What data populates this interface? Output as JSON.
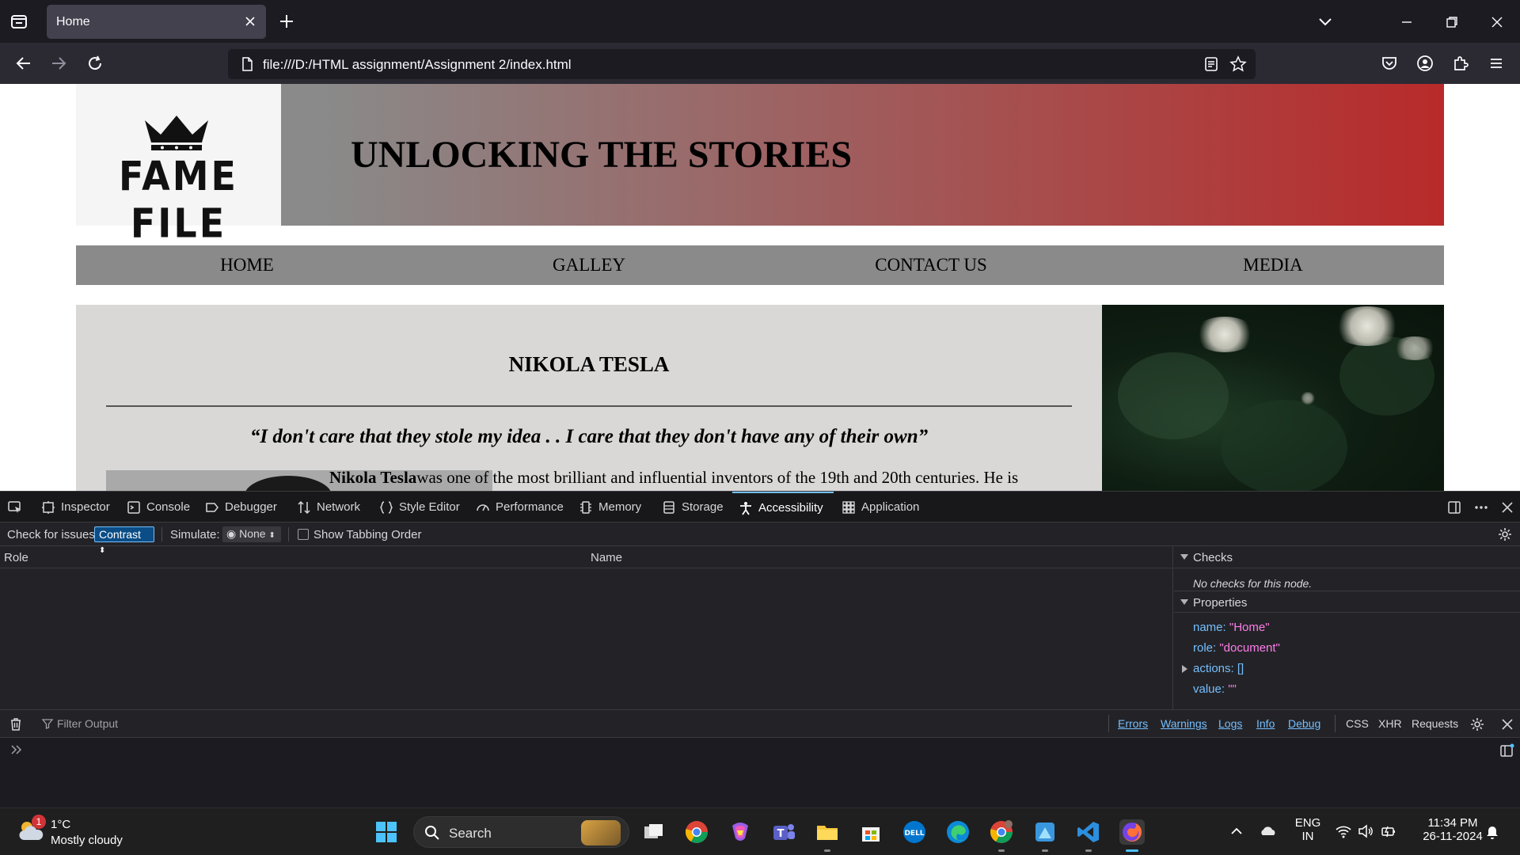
{
  "browser": {
    "tab_title": "Home",
    "url": "file:///D:/HTML assignment/Assignment 2/index.html"
  },
  "page": {
    "logo_text": "FAME FILE",
    "header_title": "UNLOCKING THE STORIES",
    "menu": [
      "HOME",
      "GALLEY",
      "CONTACT US",
      "MEDIA"
    ],
    "article": {
      "title": "NIKOLA TESLA",
      "quote": "“I don't care that they stole my idea . . I care that they don't have any of their own”",
      "body_name": "Nikola Tesla",
      "body_text": "was one of the most brilliant and influential inventors of the 19th and 20th centuries. He is"
    }
  },
  "devtools": {
    "tabs": [
      {
        "label": "Inspector",
        "icon": "inspector-icon"
      },
      {
        "label": "Console",
        "icon": "console-icon"
      },
      {
        "label": "Debugger",
        "icon": "debugger-icon"
      },
      {
        "label": "Network",
        "icon": "network-icon"
      },
      {
        "label": "Style Editor",
        "icon": "style-editor-icon"
      },
      {
        "label": "Performance",
        "icon": "performance-icon"
      },
      {
        "label": "Memory",
        "icon": "memory-icon"
      },
      {
        "label": "Storage",
        "icon": "storage-icon"
      },
      {
        "label": "Accessibility",
        "icon": "accessibility-icon"
      },
      {
        "label": "Application",
        "icon": "application-icon"
      }
    ],
    "active_tab": "Accessibility",
    "toolbar": {
      "check_label": "Check for issues:",
      "check_value": "Contrast",
      "simulate_label": "Simulate:",
      "simulate_value": "None",
      "tabbing_label": "Show Tabbing Order"
    },
    "tree": {
      "col_role": "Role",
      "col_name": "Name"
    },
    "sidebar": {
      "checks_label": "Checks",
      "no_checks": "No checks for this node.",
      "properties_label": "Properties",
      "properties": [
        {
          "key": "name:",
          "value": "\"Home\""
        },
        {
          "key": "role:",
          "value": "\"document\""
        },
        {
          "key": "actions:",
          "value": "[]"
        },
        {
          "key": "value:",
          "value": "\"\""
        }
      ]
    },
    "console": {
      "filter_placeholder": "Filter Output",
      "filters": [
        "Errors",
        "Warnings",
        "Logs",
        "Info",
        "Debug"
      ],
      "extra": [
        "CSS",
        "XHR",
        "Requests"
      ]
    }
  },
  "taskbar": {
    "weather_temp": "1°C",
    "weather_desc": "Mostly cloudy",
    "weather_badge": "1",
    "search_label": "Search",
    "lang_top": "ENG",
    "lang_bottom": "IN",
    "time": "11:34 PM",
    "date": "26-11-2024"
  },
  "colors": {
    "accent": "#75bfff",
    "header_gradient_end": "#b82a2a",
    "menu_bg": "#8a8a8a",
    "article_bg": "#d9d8d7"
  }
}
